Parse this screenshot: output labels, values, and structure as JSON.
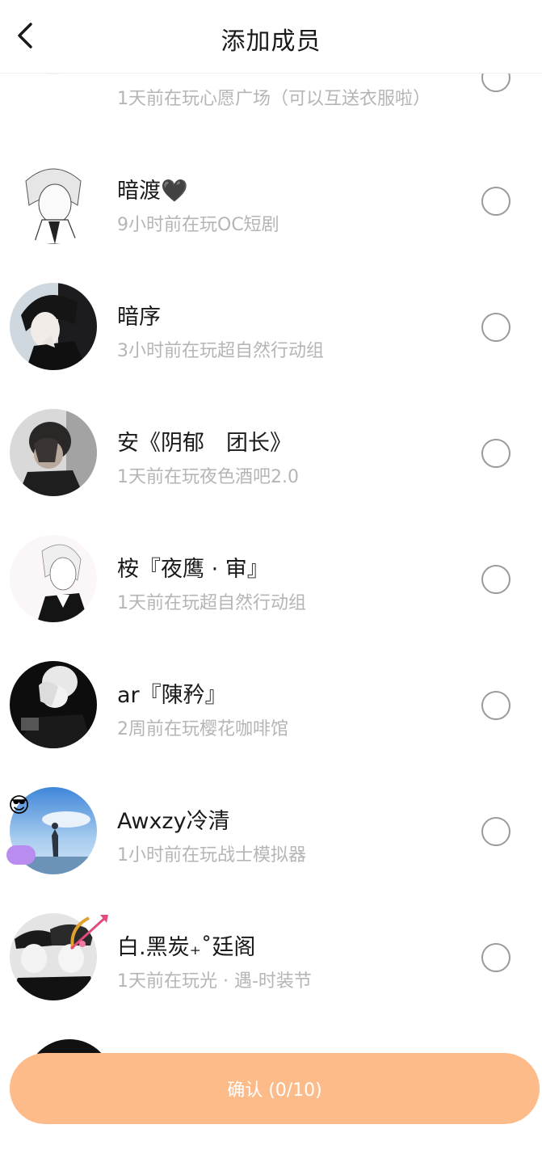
{
  "header": {
    "title": "添加成员",
    "back_icon": "chevron-left-icon"
  },
  "members": [
    {
      "name": "",
      "activity": "1天前在玩心愿广场（可以互送衣服啦）",
      "avatar": "headphones-avatar"
    },
    {
      "name": "暗渡🖤",
      "activity": "9小时前在玩OC短剧",
      "avatar": "sketch-boy-avatar"
    },
    {
      "name": "暗序",
      "activity": "3小时前在玩超自然行动组",
      "avatar": "dark-hair-boy-avatar"
    },
    {
      "name": "安《阴郁　团长》",
      "activity": "1天前在玩夜色酒吧2.0",
      "avatar": "face-covered-avatar"
    },
    {
      "name": "桉『夜鹰 · 审』",
      "activity": "1天前在玩超自然行动组",
      "avatar": "white-hair-boy-avatar"
    },
    {
      "name": "ar『陳矜』",
      "activity": "2周前在玩樱花咖啡馆",
      "avatar": "hand-cover-avatar"
    },
    {
      "name": "Awxzy冷清",
      "activity": "1小时前在玩战士模拟器",
      "avatar": "sky-hiker-avatar"
    },
    {
      "name": "白.黑炭₊˚廷阁",
      "activity": "1天前在玩光 · 遇-时装节",
      "avatar": "cap-boys-avatar"
    }
  ],
  "confirm": {
    "label": "确认 (0/10)"
  },
  "colors": {
    "accent": "#fdbb8a",
    "text_primary": "#1a1a1a",
    "text_secondary": "#b5b5b5",
    "radio_border": "#9a9a9a"
  }
}
